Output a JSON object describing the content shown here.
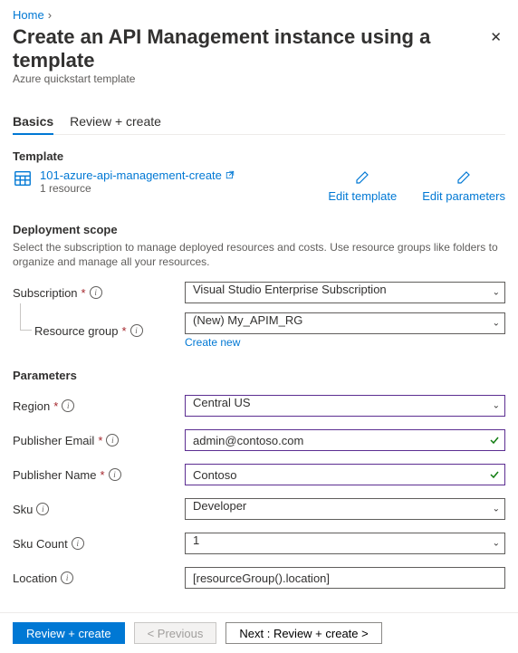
{
  "breadcrumb": {
    "home": "Home"
  },
  "heading": {
    "title": "Create an API Management instance using a template",
    "subtitle": "Azure quickstart template"
  },
  "tabs": {
    "basics": "Basics",
    "review": "Review + create"
  },
  "template": {
    "section": "Template",
    "name": "101-azure-api-management-create",
    "resources": "1 resource",
    "edit_template": "Edit template",
    "edit_parameters": "Edit parameters"
  },
  "scope": {
    "section": "Deployment scope",
    "desc": "Select the subscription to manage deployed resources and costs. Use resource groups like folders to organize and manage all your resources.",
    "subscription_label": "Subscription",
    "subscription_value": "Visual Studio Enterprise Subscription",
    "rg_label": "Resource group",
    "rg_value": "(New) My_APIM_RG",
    "create_new": "Create new"
  },
  "params": {
    "section": "Parameters",
    "region_label": "Region",
    "region_value": "Central US",
    "pub_email_label": "Publisher Email",
    "pub_email_value": "admin@contoso.com",
    "pub_name_label": "Publisher Name",
    "pub_name_value": "Contoso",
    "sku_label": "Sku",
    "sku_value": "Developer",
    "sku_count_label": "Sku Count",
    "sku_count_value": "1",
    "location_label": "Location",
    "location_value": "[resourceGroup().location]"
  },
  "footer": {
    "review": "Review + create",
    "previous": "< Previous",
    "next": "Next : Review + create >"
  }
}
